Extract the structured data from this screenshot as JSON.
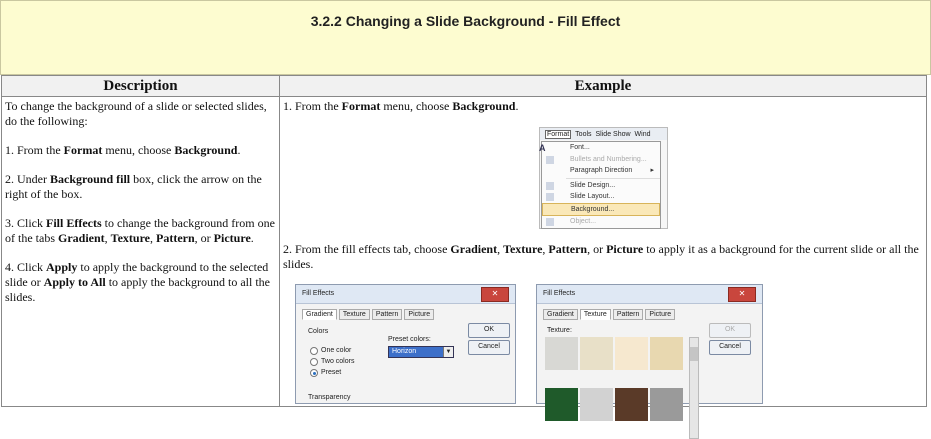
{
  "banner": {
    "title": "3.2.2 Changing a Slide Background - Fill Effect"
  },
  "table": {
    "headers": [
      "Description",
      "Example"
    ],
    "description": {
      "intro": "To change the background of a slide or selected slides, do the following:",
      "step1": {
        "a": "1. From the ",
        "b": "Format",
        "c": " menu, choose ",
        "d": "Background",
        "e": "."
      },
      "step2": {
        "a": "2. Under ",
        "b": "Background fill",
        "c": " box, click the arrow on the right of the box."
      },
      "step3": {
        "a": "3. Click ",
        "b": "Fill Effects",
        "c": " to change the background from one of the tabs ",
        "d": "Gradient",
        "e": ", ",
        "f": "Texture",
        "g": ", ",
        "h": "Pattern",
        "i": ", or ",
        "j": "Picture",
        "k": "."
      },
      "step4": {
        "a": "4. Click ",
        "b": "Apply",
        "c": " to apply the background to the selected slide or ",
        "d": "Apply to All",
        "e": " to apply the background to all the slides."
      }
    },
    "example": {
      "step1": {
        "a": "1. From the ",
        "b": "Format",
        "c": " menu, choose ",
        "d": "Background",
        "e": "."
      },
      "step2": {
        "a": "2. From the fill effects tab, choose ",
        "b": "Gradient",
        "c": ", ",
        "d": "Texture",
        "e": ", ",
        "f": "Pattern",
        "g": ", or ",
        "h": "Picture",
        "i": " to apply it as a background for the current slide or all the slides."
      }
    }
  },
  "menu_shot": {
    "bar": [
      "Format",
      "Tools",
      "Slide Show",
      "Wind"
    ],
    "items": [
      "Font...",
      "Bullets and Numbering...",
      "Paragraph Direction",
      "Slide Design...",
      "Slide Layout...",
      "Background...",
      "Object..."
    ],
    "letter": "A"
  },
  "dialog1": {
    "title": "Fill Effects",
    "tabs": [
      "Gradient",
      "Texture",
      "Pattern",
      "Picture"
    ],
    "colors_label": "Colors",
    "radios": [
      "One color",
      "Two colors",
      "Preset"
    ],
    "preset_label": "Preset colors:",
    "preset_value": "Horizon",
    "transparency_label": "Transparency",
    "ok": "OK",
    "cancel": "Cancel"
  },
  "dialog2": {
    "title": "Fill Effects",
    "tabs": [
      "Gradient",
      "Texture",
      "Pattern",
      "Picture"
    ],
    "textures_label": "Texture:",
    "ok": "OK",
    "cancel": "Cancel",
    "swatches": [
      "#d8d8d4",
      "#e8e0c8",
      "#f6e8cf",
      "#e8d8b0",
      "#1f5a2a",
      "#d2d2d2",
      "#5a3a28",
      "#9a9a9a"
    ]
  },
  "colors": {
    "banner_bg": "#fdfcd0",
    "header_bg": "#f1f1f1",
    "menu_highlight": "#fae8b8",
    "close_button": "#c9463d"
  }
}
